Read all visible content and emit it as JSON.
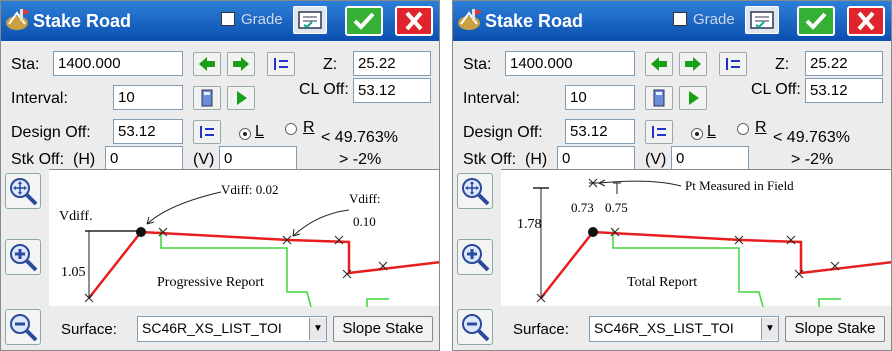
{
  "panels": [
    {
      "title": "Stake Road",
      "grade_label": "Grade",
      "sta_label": "Sta:",
      "sta_value": "1400.000",
      "z_label": "Z:",
      "z_value": "25.22",
      "interval_label": "Interval:",
      "interval_value": "10",
      "cl_off_label": "CL Off:",
      "cl_off_value": "53.12",
      "design_off_label": "Design Off:",
      "design_off_value": "53.12",
      "radio_l": "L",
      "radio_r": "R",
      "slope_pct": "< 49.763%",
      "grade_pct": "> -2%",
      "stk_off_label": "Stk Off:",
      "h_label": "(H)",
      "h_value": "0",
      "v_label": "(V)",
      "v_value": "0",
      "surface_label": "Surface:",
      "surface_value": "SC46R_XS_LIST_TOI",
      "slope_stake_label": "Slope Stake",
      "plot": {
        "vdiff_label": "Vdiff.",
        "vdiff_value": "1.05",
        "annot_1": "Vdiff: 0.02",
        "annot_2a": "Vdiff:",
        "annot_2b": "0.10",
        "report": "Progressive Report"
      }
    },
    {
      "title": "Stake Road",
      "grade_label": "Grade",
      "sta_label": "Sta:",
      "sta_value": "1400.000",
      "z_label": "Z:",
      "z_value": "25.22",
      "interval_label": "Interval:",
      "interval_value": "10",
      "cl_off_label": "CL Off:",
      "cl_off_value": "53.12",
      "design_off_label": "Design Off:",
      "design_off_value": "53.12",
      "radio_l": "L",
      "radio_r": "R",
      "slope_pct": "< 49.763%",
      "grade_pct": "> -2%",
      "stk_off_label": "Stk Off:",
      "h_label": "(H)",
      "h_value": "0",
      "v_label": "(V)",
      "v_value": "0",
      "surface_label": "Surface:",
      "surface_value": "SC46R_XS_LIST_TOI",
      "slope_stake_label": "Slope Stake",
      "plot": {
        "vdiff_value": "1.78",
        "annot_1": "Pt Measured in Field",
        "annot_2a": "0.73",
        "annot_2b": "0.75",
        "report": "Total Report"
      }
    }
  ],
  "colors": {
    "titlebar": "#1463c4",
    "design_line": "#e81e1e",
    "surface_line": "#3ed63e",
    "accent_ok": "#35b035",
    "accent_cancel": "#e0242b"
  },
  "icons": [
    "road-stake-icon",
    "configure-icon",
    "check-icon",
    "close-icon",
    "arrow-left-icon",
    "arrow-right-icon",
    "list-icon",
    "calculator-icon",
    "play-icon",
    "zoom-extents-icon",
    "zoom-in-icon",
    "zoom-out-icon"
  ]
}
